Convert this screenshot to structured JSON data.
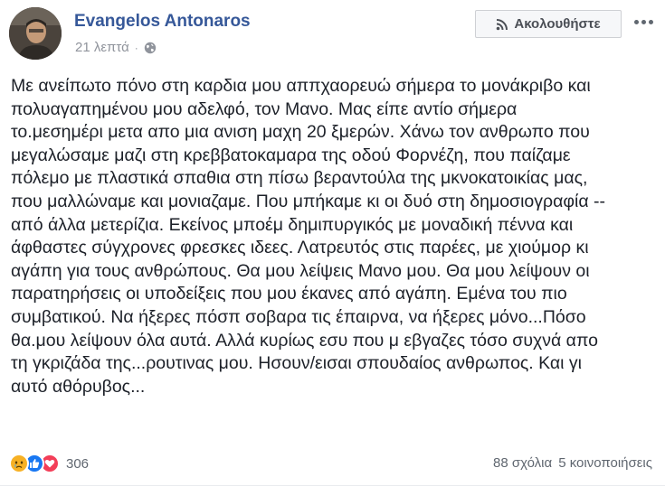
{
  "post": {
    "author": "Evangelos Antonaros",
    "time": "21 λεπτά",
    "separator": "·",
    "audience_icon": "globe-icon",
    "follow_label": "Ακολουθήστε",
    "follow_icon": "rss-icon",
    "more_icon": "more-dots-icon",
    "text_lines": [
      "Με ανείπωτο πόνο στη καρδια μου αππχαορευώ σήμερα το μονάκριβο και",
      "πολυαγαπημένου μου αδελφό, τον Μανο. Μας είπε αντίο σήμερα",
      "το.μεσημέρι μετα απο μια ανιση μαχη 20 ξμερών. Χάνω τον ανθρωπο που",
      "μεγαλώσαμε μαζι στη κρεββατοκαμαρα της οδού Φορνέζη, που παίζαμε",
      "πόλεμο με πλαστικά σπαθια στη πίσω βεραντούλα της μκνοκατοικίας μας,",
      "που μαλλώναμε και μονιαζαμε. Που μπήκαμε κι οι δυό στη δημοσιογραφία --",
      "από άλλα μετερίζια. Εκείνος μποέμ δημιπυργικός με μοναδική πέννα και",
      "άφθαστες σύγχρονες φρεσκες ιδεες. Λατρευτός στις παρέες, με χιούμορ κι",
      "αγάπη για τους ανθρώπους. Θα μου λείψεις Μανο μου. Θα μου λείψουν οι",
      "παρατηρήσεις οι υποδείξεις που μου έκανες από αγάπη. Εμένα του πιο",
      "συμβατικού. Να ήξερες πόσπ σοβαρα τις έπαιρνα, να ήξερες μόνο...Πόσο",
      "θα.μου λείψουν όλα αυτά. Αλλά κυρίως εσυ που μ εβγαζες τόσο συχνά απο",
      "τη γκριζάδα της...ρουτινας μου. Ησουν/εισαι σπουδαίος ανθρωπος. Και γι",
      "αυτό αθόρυβος..."
    ]
  },
  "footer": {
    "reactions": [
      {
        "name": "sad-reaction-icon",
        "color": "#f7b125"
      },
      {
        "name": "like-reaction-icon",
        "color": "#1877f2"
      },
      {
        "name": "love-reaction-icon",
        "color": "#f33e58"
      }
    ],
    "reaction_count": "306",
    "comments": "88 σχόλια",
    "shares": "5 κοινοποιήσεις"
  }
}
